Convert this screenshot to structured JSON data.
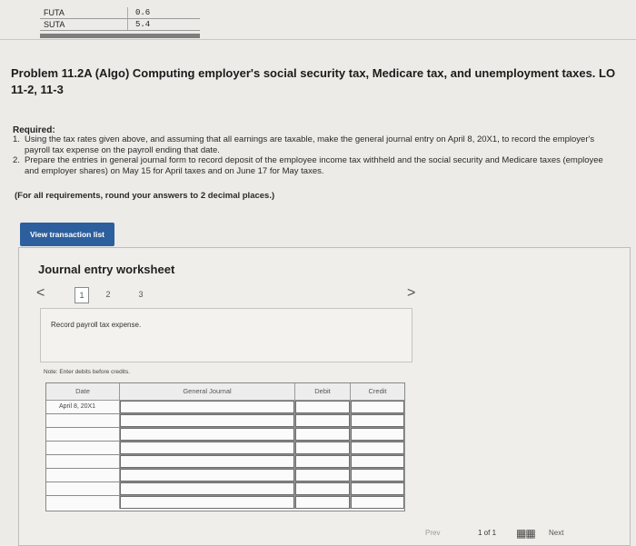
{
  "rates": [
    {
      "name": "FUTA",
      "value": "0.6"
    },
    {
      "name": "SUTA",
      "value": "5.4"
    }
  ],
  "problem": {
    "title": "Problem 11.2A (Algo) Computing employer's social security tax, Medicare tax, and unemployment taxes. LO 11-2, 11-3",
    "required_label": "Required:",
    "requirements": [
      {
        "num": "1.",
        "text": "Using the tax rates given above, and assuming that all earnings are taxable, make the general journal entry on April 8, 20X1, to record the employer's payroll tax expense on the payroll ending that date."
      },
      {
        "num": "2.",
        "text": "Prepare the entries in general journal form to record deposit of the employee income tax withheld and the social security and Medicare taxes (employee and employer shares) on May 15 for April taxes and on June 17 for May taxes."
      }
    ],
    "note": "(For all requirements, round your answers to 2 decimal places.)"
  },
  "view_button": "View transaction list",
  "worksheet": {
    "title": "Journal entry worksheet",
    "prev_glyph": "<",
    "next_glyph": ">",
    "pages": [
      "1",
      "2",
      "3"
    ],
    "description": "Record payroll tax expense.",
    "note": "Note: Enter debits before credits."
  },
  "journal": {
    "headers": {
      "date": "Date",
      "general": "General Journal",
      "debit": "Debit",
      "credit": "Credit"
    },
    "first_date": "April 8, 20X1"
  },
  "pager": {
    "prev": "Prev",
    "count": "1 of 1",
    "next": "Next"
  }
}
